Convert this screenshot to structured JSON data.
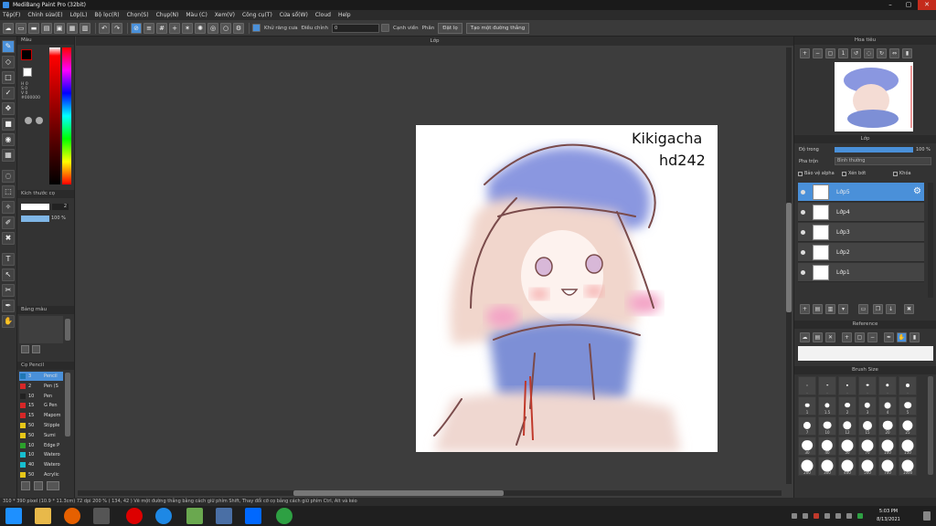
{
  "window": {
    "title": "MediBang Paint Pro (32bit)",
    "buttons": [
      "–",
      "▢",
      "✕"
    ]
  },
  "menu": [
    "Tệp(F)",
    "Chỉnh sửa(E)",
    "Lớp(L)",
    "Bộ lọc(R)",
    "Chọn(S)",
    "Chụp(N)",
    "Màu (C)",
    "Xem(V)",
    "Công cụ(T)",
    "Cửa sổ(W)",
    "Cloud",
    "Help"
  ],
  "toolbar": {
    "anti_alias_label": "Khử răng cưa",
    "stabilizer_label": "Điều chỉnh",
    "stabilizer_value": "0",
    "edge_label": "Cạnh viền",
    "snap_label": "Phân",
    "snap_off": "Đặt lọ",
    "new_snap": "Tạo một đường thẳng"
  },
  "color_panel": {
    "title": "Màu",
    "h": "H 0",
    "s": "S 0",
    "v": "V 0",
    "hex": "#000000",
    "colors": {
      "foreground": "#000000",
      "background": "#ffffff",
      "accent": "#4a90d9"
    }
  },
  "brush_size_panel": {
    "title": "Kích thước cọ",
    "size": "2",
    "opacity": "100 %"
  },
  "color_set_panel": {
    "title": "Bảng màu"
  },
  "brush_list_panel": {
    "title": "Cọ Pencil",
    "items": [
      {
        "size": "3",
        "name": "Pencil",
        "color": "#1f77b4",
        "sel": true
      },
      {
        "size": "2",
        "name": "Pen (S",
        "color": "#d62728"
      },
      {
        "size": "10",
        "name": "Pen",
        "color": "#222222"
      },
      {
        "size": "15",
        "name": "G Pen",
        "color": "#d62728"
      },
      {
        "size": "15",
        "name": "Mapom",
        "color": "#d62728"
      },
      {
        "size": "50",
        "name": "Stipple",
        "color": "#e6c619"
      },
      {
        "size": "50",
        "name": "Sumi",
        "color": "#e6c619"
      },
      {
        "size": "10",
        "name": "Edge P",
        "color": "#2ca02c"
      },
      {
        "size": "10",
        "name": "Watero",
        "color": "#17becf"
      },
      {
        "size": "40",
        "name": "Watero",
        "color": "#17becf"
      },
      {
        "size": "50",
        "name": "Acrylic",
        "color": "#e6c619"
      }
    ]
  },
  "document": {
    "tab": "Lớp"
  },
  "navigator": {
    "title": "Hoa tiêu"
  },
  "layer_panel": {
    "title": "Lớp",
    "opacity_label": "Độ trong",
    "opacity_value": "100 %",
    "blend_label": "Pha trộn",
    "blend_value": "Bình thường",
    "protect_alpha": "Bảo vệ alpha",
    "clipping": "Xén bớt",
    "lock": "Khóa",
    "layers": [
      "Lớp5",
      "Lớp4",
      "Lớp3",
      "Lớp2",
      "Lớp1"
    ]
  },
  "reference_panel": {
    "title": "Reference"
  },
  "brush_size_grid": {
    "title": "Brush Size",
    "sizes": [
      ".",
      ".",
      ".",
      ".",
      ".",
      ".",
      "1",
      "1.5",
      "2",
      "3",
      "4",
      "5",
      "7",
      "10",
      "12",
      "15",
      "20",
      "25",
      "30",
      "40",
      "50",
      "70",
      "100",
      "150",
      "200",
      "300",
      "400",
      "500",
      "700",
      "1000"
    ]
  },
  "status": "310 * 390 pixel  (10.9 * 11.3cm)  72 dpi  200 %  ( 134, 42 )  Vẽ một đường thẳng bằng cách giữ phím Shift, Thay đổi cỡ cọ bằng cách giữ phím Ctrl, Alt và kéo",
  "taskbar": {
    "time": "5:03 PM",
    "date": "8/13/2021"
  },
  "artwork_text": [
    "Kikigacha",
    "hd242"
  ]
}
